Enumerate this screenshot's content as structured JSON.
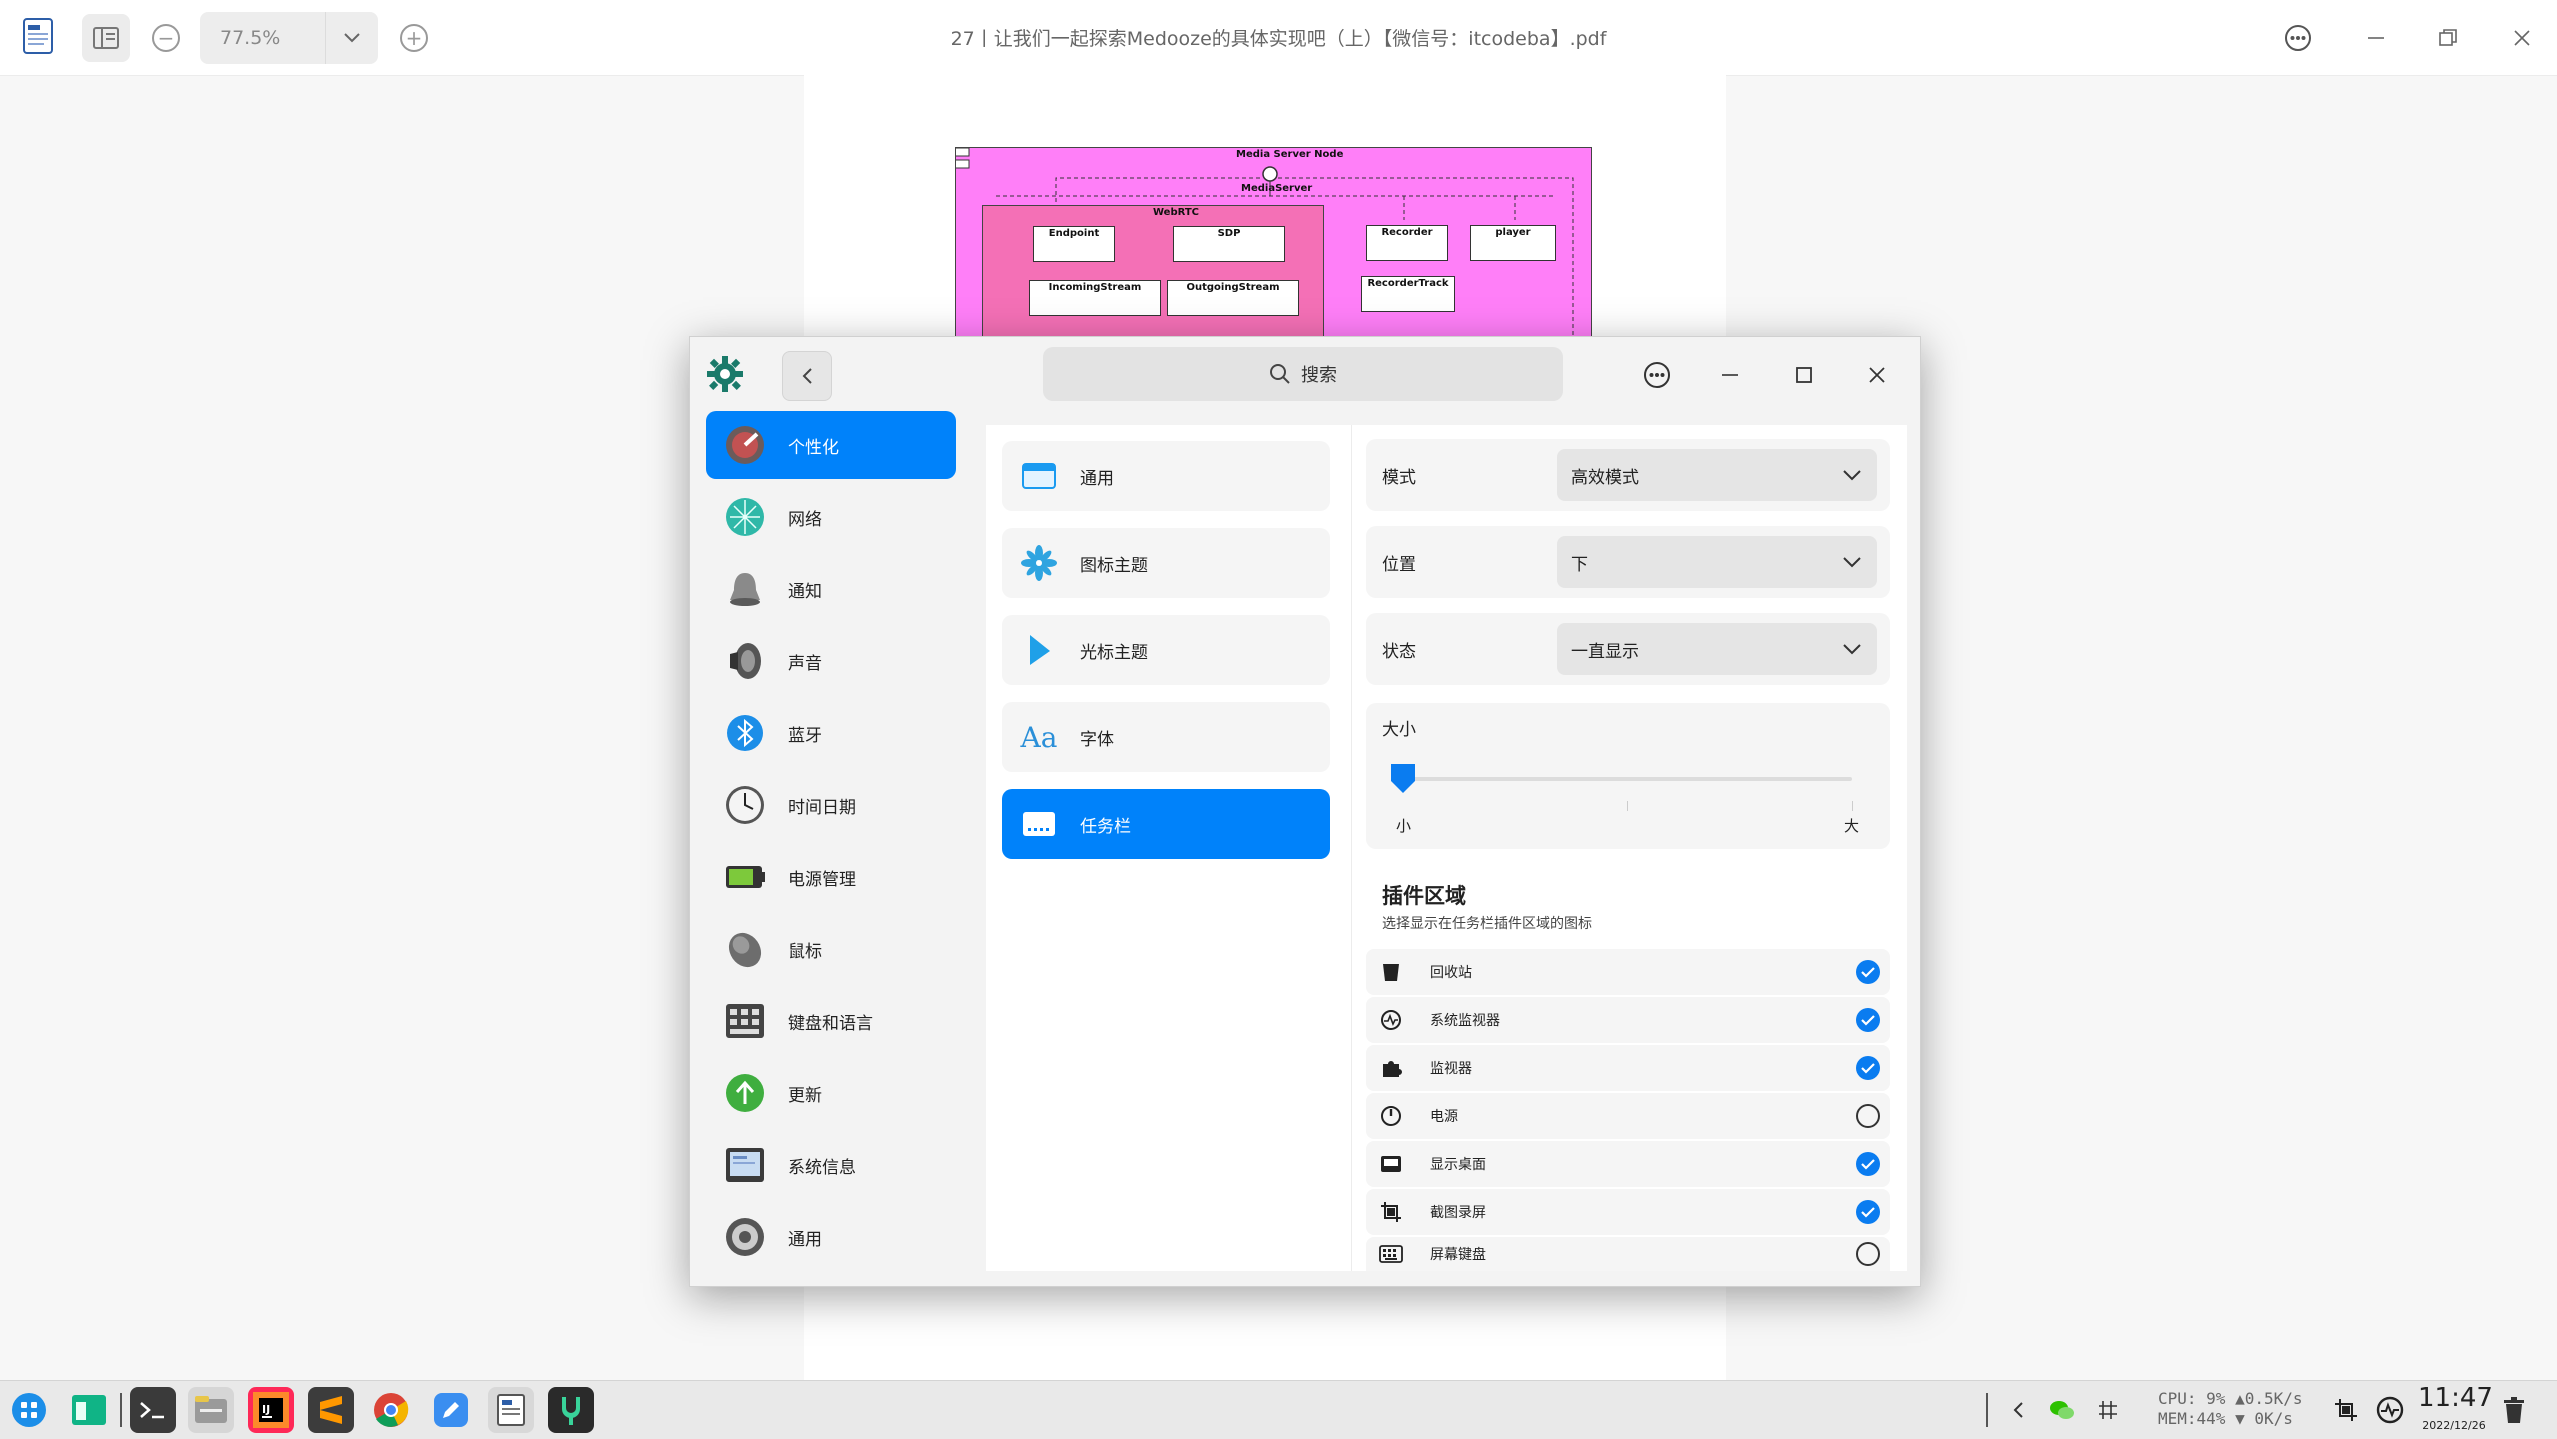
{
  "viewer": {
    "title": "27丨让我们一起探索Medooze的具体实现吧（上）【微信号：itcodeba】.pdf",
    "zoom": "77.5%"
  },
  "diagram": {
    "node": "Media Server Node",
    "mediaserver": "MediaServer",
    "webrtc": "WebRTC",
    "boxes": [
      "Endpoint",
      "SDP",
      "Recorder",
      "player",
      "IncomingStream",
      "OutgoingStream",
      "RecorderTrack"
    ]
  },
  "settings": {
    "search_placeholder": "搜索",
    "nav": [
      {
        "label": "个性化",
        "icon": "personalization-icon"
      },
      {
        "label": "网络",
        "icon": "network-icon"
      },
      {
        "label": "通知",
        "icon": "bell-icon"
      },
      {
        "label": "声音",
        "icon": "speaker-icon"
      },
      {
        "label": "蓝牙",
        "icon": "bluetooth-icon"
      },
      {
        "label": "时间日期",
        "icon": "clock-icon"
      },
      {
        "label": "电源管理",
        "icon": "battery-icon"
      },
      {
        "label": "鼠标",
        "icon": "mouse-icon"
      },
      {
        "label": "键盘和语言",
        "icon": "keyboard-icon"
      },
      {
        "label": "更新",
        "icon": "update-icon"
      },
      {
        "label": "系统信息",
        "icon": "system-info-icon"
      },
      {
        "label": "通用",
        "icon": "general-icon"
      }
    ],
    "sub": [
      {
        "label": "通用"
      },
      {
        "label": "图标主题"
      },
      {
        "label": "光标主题"
      },
      {
        "label": "字体"
      },
      {
        "label": "任务栏"
      }
    ],
    "mode": {
      "label": "模式",
      "value": "高效模式"
    },
    "position": {
      "label": "位置",
      "value": "下"
    },
    "state": {
      "label": "状态",
      "value": "一直显示"
    },
    "size": {
      "label": "大小",
      "min": "小",
      "max": "大",
      "value_fraction": 0.0
    },
    "plugins": {
      "title": "插件区域",
      "desc": "选择显示在任务栏插件区域的图标",
      "items": [
        {
          "label": "回收站",
          "checked": true
        },
        {
          "label": "系统监视器",
          "checked": true
        },
        {
          "label": "监视器",
          "checked": true
        },
        {
          "label": "电源",
          "checked": false
        },
        {
          "label": "显示桌面",
          "checked": true
        },
        {
          "label": "截图录屏",
          "checked": true
        },
        {
          "label": "屏幕键盘",
          "checked": false
        }
      ]
    }
  },
  "taskbar": {
    "cpu": "CPU: 9% ▲0.5K/s",
    "mem": "MEM:44% ▼  0K/s",
    "time": "11:47",
    "date": "2022/12/26"
  },
  "colors": {
    "accent": "#0082fa",
    "diagram_bg": "#ff7ff8",
    "diagram_inner": "#f470b6"
  }
}
